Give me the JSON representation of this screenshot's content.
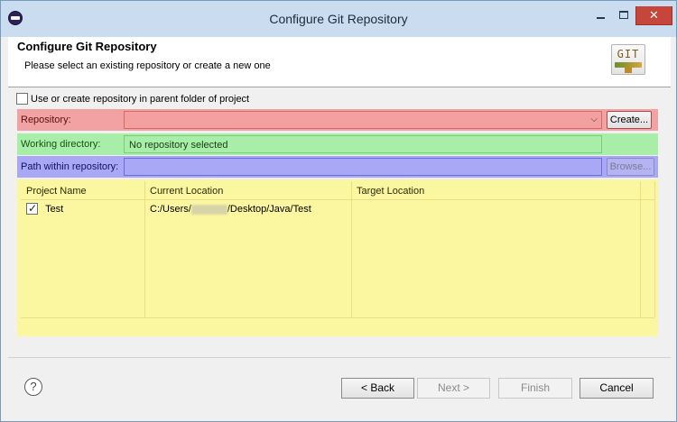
{
  "window": {
    "title": "Configure Git Repository",
    "controls": {
      "minimize": "minimize-icon",
      "maximize": "maximize-icon",
      "close": "✕"
    }
  },
  "header": {
    "title": "Configure Git Repository",
    "description": "Please select an existing repository or create a new one",
    "logo_text": "GIT"
  },
  "options": {
    "parent_folder_label": "Use or create repository in parent folder of project",
    "parent_folder_checked": false
  },
  "form": {
    "repository_label": "Repository:",
    "repository_value": "",
    "create_button": "Create...",
    "working_dir_label": "Working directory:",
    "working_dir_value": "No repository selected",
    "path_label": "Path within repository:",
    "path_value": "",
    "browse_button": "Browse..."
  },
  "table": {
    "columns": [
      "Project Name",
      "Current Location",
      "Target Location"
    ],
    "rows": [
      {
        "checked": true,
        "project": "Test",
        "location_prefix": "C:/Users/",
        "location_suffix": "/Desktop/Java/Test",
        "target": ""
      }
    ]
  },
  "footer": {
    "help": "?",
    "back": "< Back",
    "next": "Next >",
    "finish": "Finish",
    "cancel": "Cancel"
  },
  "colors": {
    "repository_band": "#f2a2a2",
    "working_dir_band": "#a8eea8",
    "path_band": "#a8a8f7",
    "table_band": "#fbf7a1"
  }
}
